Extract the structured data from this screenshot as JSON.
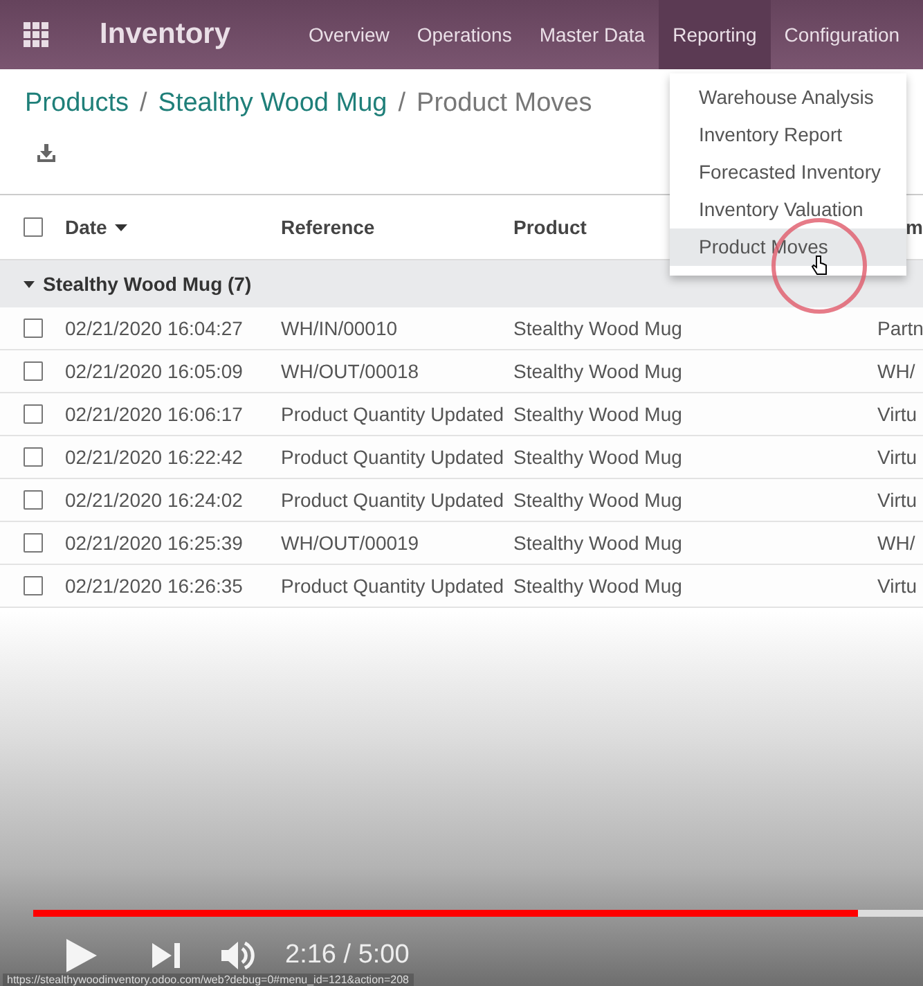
{
  "navbar": {
    "app_title": "Inventory",
    "menu": [
      {
        "label": "Overview",
        "selected": false
      },
      {
        "label": "Operations",
        "selected": false
      },
      {
        "label": "Master Data",
        "selected": false
      },
      {
        "label": "Reporting",
        "selected": true
      },
      {
        "label": "Configuration",
        "selected": false
      }
    ]
  },
  "breadcrumb": [
    {
      "label": "Products",
      "kind": "link"
    },
    {
      "label": "/",
      "kind": "separator"
    },
    {
      "label": "Stealthy Wood Mug",
      "kind": "link"
    },
    {
      "label": "/",
      "kind": "separator"
    },
    {
      "label": "Product Moves",
      "kind": "current"
    }
  ],
  "table": {
    "columns": [
      {
        "label": "Date",
        "sorted": true
      },
      {
        "label": "Reference",
        "sorted": false
      },
      {
        "label": "Product",
        "sorted": false
      },
      {
        "label": "m",
        "sorted": false
      }
    ],
    "select_all_checked": false,
    "group": {
      "label": "Stealthy Wood Mug (7)",
      "expanded": true
    },
    "rows": [
      {
        "date": "02/21/2020 16:04:27",
        "reference": "WH/IN/00010",
        "product": "Stealthy Wood Mug",
        "column_4": "Partn",
        "checked": false
      },
      {
        "date": "02/21/2020 16:05:09",
        "reference": "WH/OUT/00018",
        "product": "Stealthy Wood Mug",
        "column_4": "WH/",
        "checked": false
      },
      {
        "date": "02/21/2020 16:06:17",
        "reference": "Product Quantity Updated",
        "product": "Stealthy Wood Mug",
        "column_4": "Virtu",
        "checked": false
      },
      {
        "date": "02/21/2020 16:22:42",
        "reference": "Product Quantity Updated",
        "product": "Stealthy Wood Mug",
        "column_4": "Virtu",
        "checked": false
      },
      {
        "date": "02/21/2020 16:24:02",
        "reference": "Product Quantity Updated",
        "product": "Stealthy Wood Mug",
        "column_4": "Virtu",
        "checked": false
      },
      {
        "date": "02/21/2020 16:25:39",
        "reference": "WH/OUT/00019",
        "product": "Stealthy Wood Mug",
        "column_4": "WH/",
        "checked": false
      },
      {
        "date": "02/21/2020 16:26:35",
        "reference": "Product Quantity Updated",
        "product": "Stealthy Wood Mug",
        "column_4": "Virtu",
        "checked": false
      }
    ]
  },
  "dropdown": {
    "items": [
      {
        "label": "Warehouse Analysis",
        "selected": false
      },
      {
        "label": "Inventory Report",
        "selected": false
      },
      {
        "label": "Forecasted Inventory",
        "selected": false
      },
      {
        "label": "Inventory Valuation",
        "selected": false
      },
      {
        "label": "Product Moves",
        "selected": true
      }
    ]
  },
  "player": {
    "level": 0.927,
    "time": "2:16 / 5:00",
    "status_url": "https://stealthywoodinventory.odoo.com/web?debug=0#menu_id=121&action=208"
  }
}
